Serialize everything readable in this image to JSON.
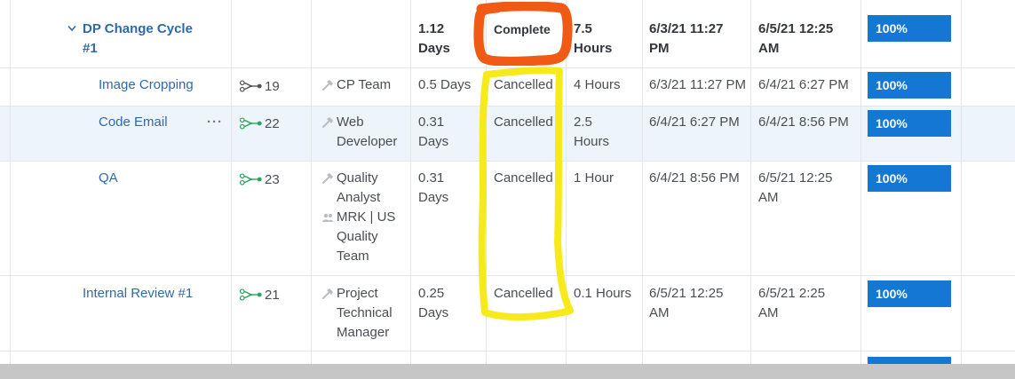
{
  "colors": {
    "accent": "#1477d4",
    "link": "#2e6aa8",
    "predecessor_green": "#2aa55a",
    "highlight_orange": "#f05a14",
    "highlight_yellow": "#f7ea1a"
  },
  "header_row": {
    "name": "DP Change Cycle",
    "name_line2": "#1",
    "duration_l1": "1.12",
    "duration_l2": "Days",
    "status": "Complete",
    "planned_hours_l1": "7.5",
    "planned_hours_l2": "Hours",
    "start_l1": "6/3/21 11:27",
    "start_l2": "PM",
    "end_l1": "6/5/21 12:25",
    "end_l2": "AM",
    "percent": "100%"
  },
  "rows": [
    {
      "name": "Image Cropping",
      "predecessor": "19",
      "role_l1": "CP Team",
      "duration_l1": "0.5 Days",
      "status": "Cancelled",
      "hours_l1": "4 Hours",
      "start_l1": "6/3/21 11:27 PM",
      "end_l1": "6/4/21 6:27 PM",
      "percent": "100%"
    },
    {
      "name": "Code Email",
      "more": "···",
      "predecessor": "22",
      "role_l1": "Web",
      "role_l2": "Developer",
      "duration_l1": "0.31",
      "duration_l2": "Days",
      "status": "Cancelled",
      "hours_l1": "2.5",
      "hours_l2": "Hours",
      "start_l1": "6/4/21 6:27 PM",
      "end_l1": "6/4/21 8:56 PM",
      "percent": "100%"
    },
    {
      "name": "QA",
      "predecessor": "23",
      "role_l1": "Quality",
      "role_l2": "Analyst",
      "team_l1": "MRK | US",
      "team_l2": "Quality",
      "team_l3": "Team",
      "duration_l1": "0.31",
      "duration_l2": "Days",
      "status": "Cancelled",
      "hours_l1": "1 Hour",
      "start_l1": "6/4/21 8:56 PM",
      "end_l1": "6/5/21 12:25",
      "end_l2": "AM",
      "percent": "100%"
    },
    {
      "name": "Internal Review #1",
      "predecessor": "21",
      "role_l1": "Project",
      "role_l2": "Technical",
      "role_l3": "Manager",
      "duration_l1": "0.25",
      "duration_l2": "Days",
      "status": "Cancelled",
      "hours_l1": "0.1 Hours",
      "start_l1": "6/5/21 12:25",
      "start_l2": "AM",
      "end_l1": "6/5/21 2:25",
      "end_l2": "AM",
      "percent": "100%"
    }
  ],
  "icons": {
    "expand": "chevron-down-icon",
    "predecessor": "predecessor-icon",
    "role": "role-icon",
    "team": "team-icon"
  }
}
